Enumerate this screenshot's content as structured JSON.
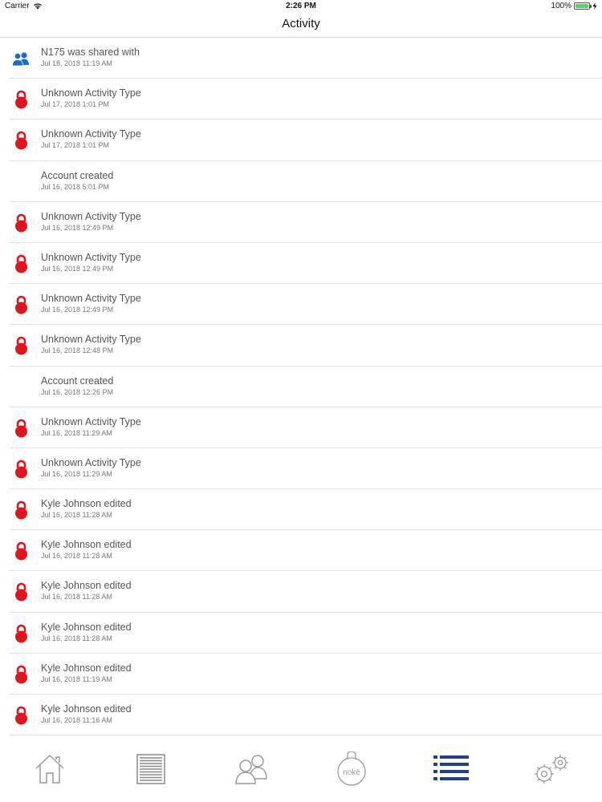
{
  "status_bar": {
    "carrier": "Carrier",
    "time": "2:26 PM",
    "battery": "100%"
  },
  "nav": {
    "title": "Activity"
  },
  "activities": [
    {
      "icon": "users-icon",
      "title": "N175 was shared with",
      "date": "Jul 18, 2018 11:19 AM"
    },
    {
      "icon": "lock-icon",
      "title": "Unknown Activity Type",
      "date": "Jul 17, 2018 1:01 PM"
    },
    {
      "icon": "lock-icon",
      "title": "Unknown Activity Type",
      "date": "Jul 17, 2018 1:01 PM"
    },
    {
      "icon": "none",
      "title": "Account created",
      "date": "Jul 16, 2018 5:01 PM"
    },
    {
      "icon": "lock-icon",
      "title": "Unknown Activity Type",
      "date": "Jul 16, 2018 12:49 PM"
    },
    {
      "icon": "lock-icon",
      "title": "Unknown Activity Type",
      "date": "Jul 16, 2018 12:49 PM"
    },
    {
      "icon": "lock-icon",
      "title": "Unknown Activity Type",
      "date": "Jul 16, 2018 12:49 PM"
    },
    {
      "icon": "lock-icon",
      "title": "Unknown Activity Type",
      "date": "Jul 16, 2018 12:48 PM"
    },
    {
      "icon": "none",
      "title": "Account created",
      "date": "Jul 16, 2018 12:26 PM"
    },
    {
      "icon": "lock-icon",
      "title": "Unknown Activity Type",
      "date": "Jul 16, 2018 11:29 AM"
    },
    {
      "icon": "lock-icon",
      "title": "Unknown Activity Type",
      "date": "Jul 16, 2018 11:29 AM"
    },
    {
      "icon": "lock-icon",
      "title": "Kyle Johnson edited",
      "date": "Jul 16, 2018 11:28 AM"
    },
    {
      "icon": "lock-icon",
      "title": "Kyle Johnson edited",
      "date": "Jul 16, 2018 11:28 AM"
    },
    {
      "icon": "lock-icon",
      "title": "Kyle Johnson edited",
      "date": "Jul 16, 2018 11:28 AM"
    },
    {
      "icon": "lock-icon",
      "title": "Kyle Johnson edited",
      "date": "Jul 16, 2018 11:28 AM"
    },
    {
      "icon": "lock-icon",
      "title": "Kyle Johnson edited",
      "date": "Jul 16, 2018 11:19 AM"
    },
    {
      "icon": "lock-icon",
      "title": "Kyle Johnson edited",
      "date": "Jul 16, 2018 11:16 AM"
    }
  ],
  "tabs": [
    {
      "name": "home-icon"
    },
    {
      "name": "garage-door-icon"
    },
    {
      "name": "people-icon"
    },
    {
      "name": "noke-lock-icon",
      "label": "nokē"
    },
    {
      "name": "activity-list-icon",
      "active": true
    },
    {
      "name": "settings-gears-icon"
    }
  ],
  "colors": {
    "lock": "#e0161f",
    "users": "#1a6fc0",
    "tab_active": "#1f3f8f",
    "tab_inactive": "#9a9a9a"
  }
}
